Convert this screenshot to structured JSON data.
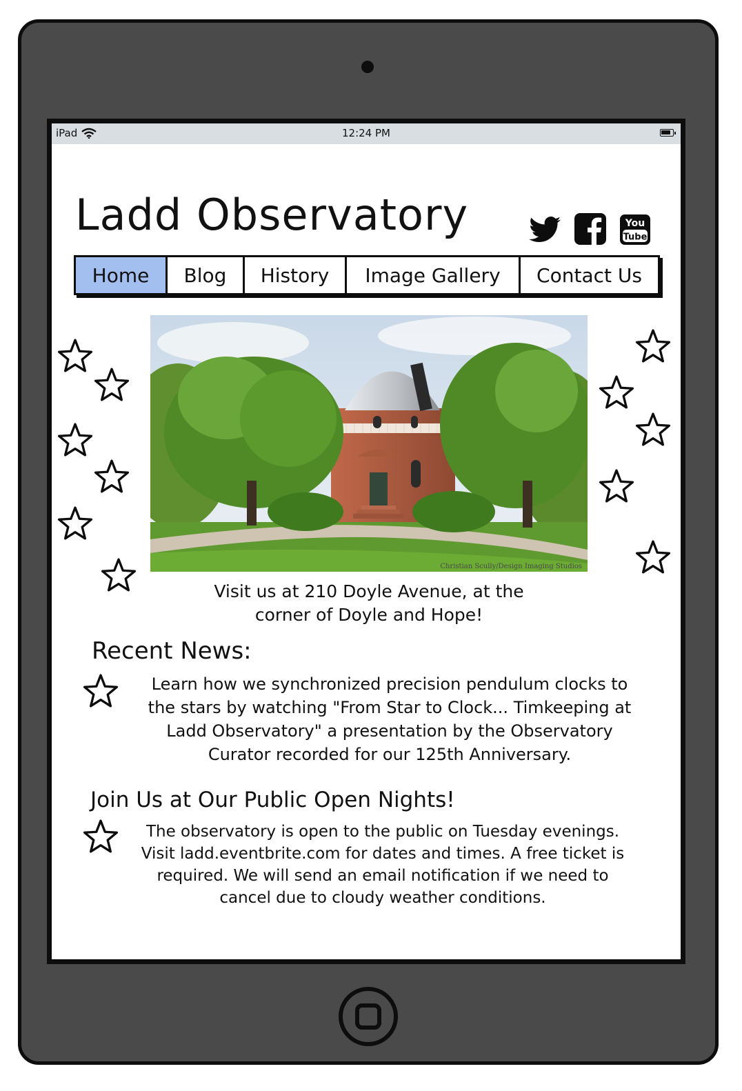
{
  "status_bar": {
    "device": "iPad",
    "time": "12:24 PM"
  },
  "site": {
    "title": "Ladd Observatory"
  },
  "social": {
    "twitter": "twitter-icon",
    "facebook": "facebook-icon",
    "youtube": "youtube-icon",
    "youtube_text_top": "You",
    "youtube_text_bottom": "Tube"
  },
  "nav": {
    "items": [
      {
        "label": "Home",
        "active": true
      },
      {
        "label": "Blog",
        "active": false
      },
      {
        "label": "History",
        "active": false
      },
      {
        "label": "Image Gallery",
        "active": false
      },
      {
        "label": "Contact Us",
        "active": false
      }
    ],
    "active_color": "#a3bff0"
  },
  "hero": {
    "credit": "Christian Scully/Design Imaging Studios",
    "caption_line1": "Visit us at 210 Doyle Avenue, at the",
    "caption_line2": "corner of Doyle and Hope!"
  },
  "news": {
    "heading": "Recent News:",
    "lines": [
      "Learn how we synchronized precision pendulum clocks to",
      "the stars by watching \"From Star to Clock... Timkeeping at",
      "Ladd Observatory\" a presentation by the Observatory",
      "Curator recorded for our 125th Anniversary."
    ]
  },
  "open_nights": {
    "heading": "Join Us at Our Public Open Nights!",
    "lines": [
      "The observatory is open to the public on Tuesday evenings.",
      "Visit ladd.eventbrite.com for dates and times. A free ticket is",
      "required. We will send an email notification if we need to",
      "cancel due to cloudy weather conditions."
    ]
  },
  "icons": {
    "decoration": "star-icon",
    "home_button": "home-button-icon",
    "camera": "camera-icon"
  }
}
